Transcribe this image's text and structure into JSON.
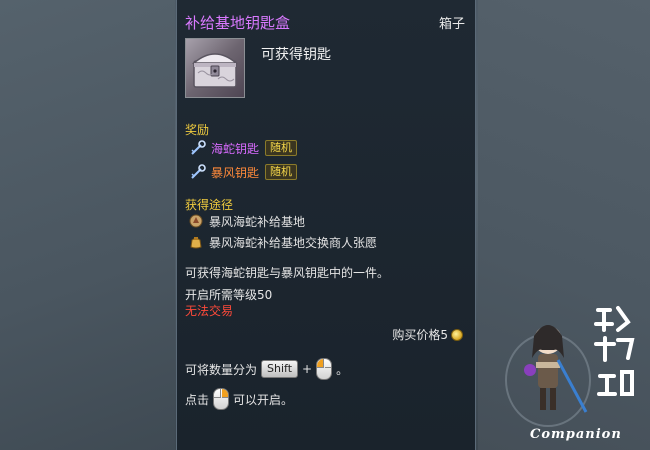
{
  "item": {
    "name": "补给基地钥匙盒",
    "type": "箱子",
    "obtain_note": "可获得钥匙",
    "icon": "silver-chest-icon"
  },
  "rewards": {
    "heading": "奖励",
    "items": [
      {
        "name": "海蛇钥匙",
        "color": "#d96bff",
        "tag": "随机",
        "icon": "key-icon"
      },
      {
        "name": "暴风钥匙",
        "color": "#ff8a3a",
        "tag": "随机",
        "icon": "key-icon"
      }
    ]
  },
  "sources": {
    "heading": "获得途径",
    "items": [
      {
        "text": "暴风海蛇补给基地",
        "icon": "dungeon-icon"
      },
      {
        "text": "暴风海蛇补给基地交换商人张愿",
        "icon": "merchant-bag-icon"
      }
    ]
  },
  "description": "可获得海蛇钥匙与暴风钥匙中的一件。",
  "level_requirement": "开启所需等级50",
  "trade_status": "无法交易",
  "price": {
    "label": "购买价格5",
    "icon": "coin-icon"
  },
  "hints": {
    "split_prefix": "可将数量分为",
    "split_key": "Shift",
    "split_plus": "+",
    "split_suffix": "。",
    "open_prefix": "点击",
    "open_suffix": "可以开启。"
  },
  "watermark": {
    "text": "Companion"
  },
  "colors": {
    "title": "#d979ff",
    "section": "#f0cb3e",
    "warning": "#ff4a3a"
  }
}
